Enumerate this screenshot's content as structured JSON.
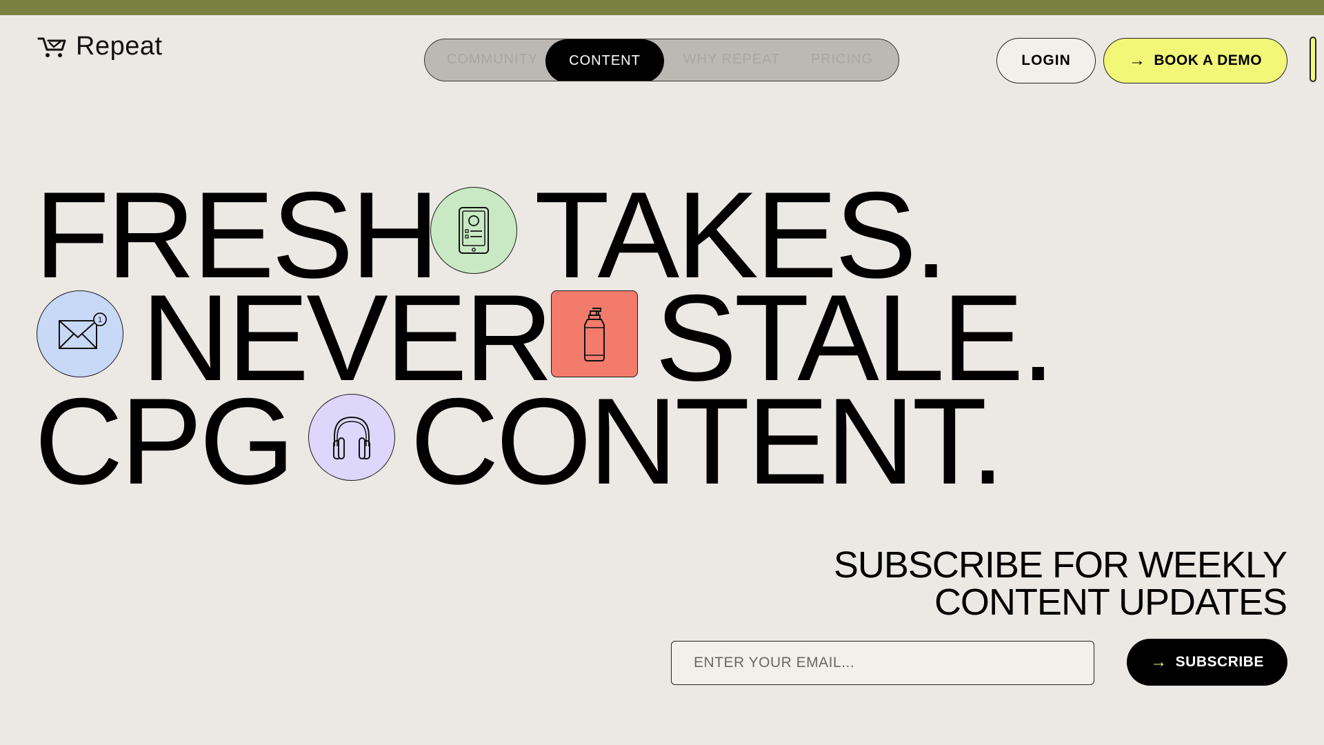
{
  "brand": {
    "name": "Repeat"
  },
  "nav": {
    "items": [
      {
        "label": "COMMUNITY"
      },
      {
        "label": "CONTENT"
      },
      {
        "label": "WHY REPEAT"
      },
      {
        "label": "PRICING"
      }
    ],
    "active_label": "CONTENT"
  },
  "header": {
    "login_label": "LOGIN",
    "demo_label": "BOOK A DEMO"
  },
  "headline": {
    "words": [
      "FRESH",
      "TAKES.",
      "NEVER",
      "STALE.",
      "CPG",
      "CONTENT."
    ],
    "badges": [
      {
        "icon": "tablet-icon",
        "color": "#c8e9c4"
      },
      {
        "icon": "mail-icon",
        "color": "#c8d8f7",
        "count": "1"
      },
      {
        "icon": "spray-bottle-icon",
        "color": "#f27b6c"
      },
      {
        "icon": "headphones-icon",
        "color": "#dcd7fb"
      }
    ]
  },
  "subscribe": {
    "heading_line1": "SUBSCRIBE FOR WEEKLY",
    "heading_line2": "CONTENT UPDATES",
    "email_placeholder": "ENTER YOUR EMAIL...",
    "button_label": "SUBSCRIBE"
  },
  "colors": {
    "top_bar": "#7a8040",
    "background": "#ece8e3",
    "accent_yellow": "#f2f777"
  }
}
